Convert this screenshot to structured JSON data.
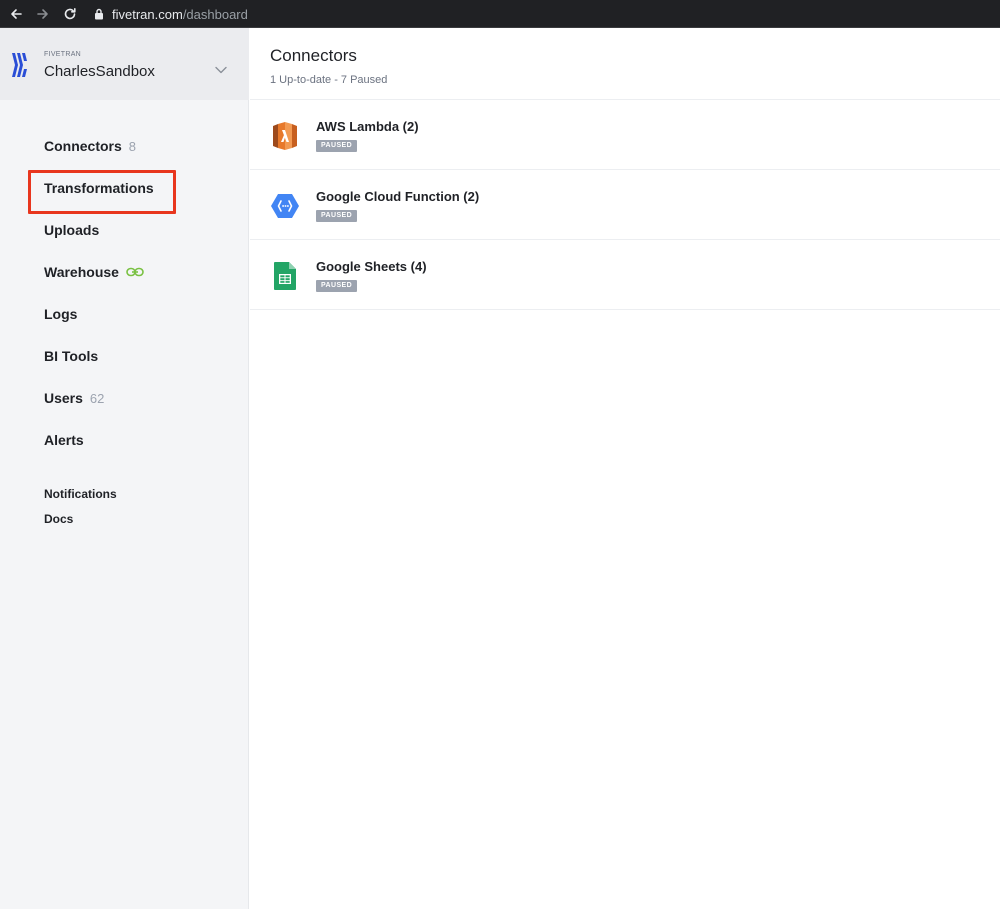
{
  "browser": {
    "url_host": "fivetran.com",
    "url_path": "/dashboard"
  },
  "account": {
    "org_label": "FIVETRAN",
    "name": "CharlesSandbox"
  },
  "sidebar": {
    "items": [
      {
        "label": "Connectors",
        "count": "8"
      },
      {
        "label": "Transformations"
      },
      {
        "label": "Uploads"
      },
      {
        "label": "Warehouse"
      },
      {
        "label": "Logs"
      },
      {
        "label": "BI Tools"
      },
      {
        "label": "Users",
        "count": "62"
      },
      {
        "label": "Alerts"
      }
    ],
    "secondary": [
      {
        "label": "Notifications"
      },
      {
        "label": "Docs"
      }
    ]
  },
  "main": {
    "title": "Connectors",
    "subtitle": "1 Up-to-date - 7 Paused",
    "connectors": [
      {
        "name": "AWS Lambda (2)",
        "status": "PAUSED",
        "icon": "aws-lambda-icon",
        "color": "#e7792b"
      },
      {
        "name": "Google Cloud Function (2)",
        "status": "PAUSED",
        "icon": "google-cloud-function-icon",
        "color": "#4285f4"
      },
      {
        "name": "Google Sheets (4)",
        "status": "PAUSED",
        "icon": "google-sheets-icon",
        "color": "#23a566"
      }
    ]
  },
  "colors": {
    "highlight": "#e8361e",
    "brand": "#2a4ed6",
    "link_icon": "#7ac143",
    "badge": "#9ca3af"
  }
}
